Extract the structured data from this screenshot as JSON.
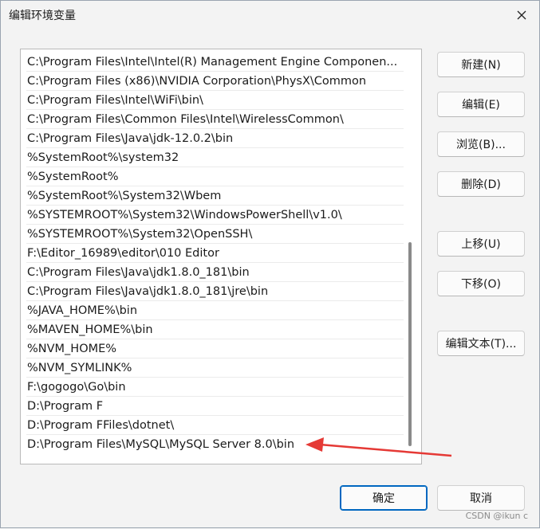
{
  "window": {
    "title": "编辑环境变量",
    "close_label": "关闭"
  },
  "paths": [
    "C:\\Program Files\\Intel\\Intel(R) Management Engine Componen...",
    "C:\\Program Files (x86)\\NVIDIA Corporation\\PhysX\\Common",
    "C:\\Program Files\\Intel\\WiFi\\bin\\",
    "C:\\Program Files\\Common Files\\Intel\\WirelessCommon\\",
    "C:\\Program Files\\Java\\jdk-12.0.2\\bin",
    "%SystemRoot%\\system32",
    "%SystemRoot%",
    "%SystemRoot%\\System32\\Wbem",
    "%SYSTEMROOT%\\System32\\WindowsPowerShell\\v1.0\\",
    "%SYSTEMROOT%\\System32\\OpenSSH\\",
    "F:\\Editor_16989\\editor\\010 Editor",
    "C:\\Program Files\\Java\\jdk1.8.0_181\\bin",
    "C:\\Program Files\\Java\\jdk1.8.0_181\\jre\\bin",
    "%JAVA_HOME%\\bin",
    "%MAVEN_HOME%\\bin",
    "%NVM_HOME%",
    "%NVM_SYMLINK%",
    "F:\\gogogo\\Go\\bin",
    "D:\\Program F",
    "D:\\Program FFiles\\dotnet\\",
    "D:\\Program Files\\MySQL\\MySQL Server 8.0\\bin"
  ],
  "buttons": {
    "new": "新建(N)",
    "edit": "编辑(E)",
    "browse": "浏览(B)...",
    "delete": "删除(D)",
    "move_up": "上移(U)",
    "move_down": "下移(O)",
    "edit_text": "编辑文本(T)...",
    "ok": "确定",
    "cancel": "取消"
  },
  "watermark": "CSDN @ikun c",
  "colors": {
    "annotation_arrow": "#e53935",
    "primary_border": "#0067c0"
  }
}
